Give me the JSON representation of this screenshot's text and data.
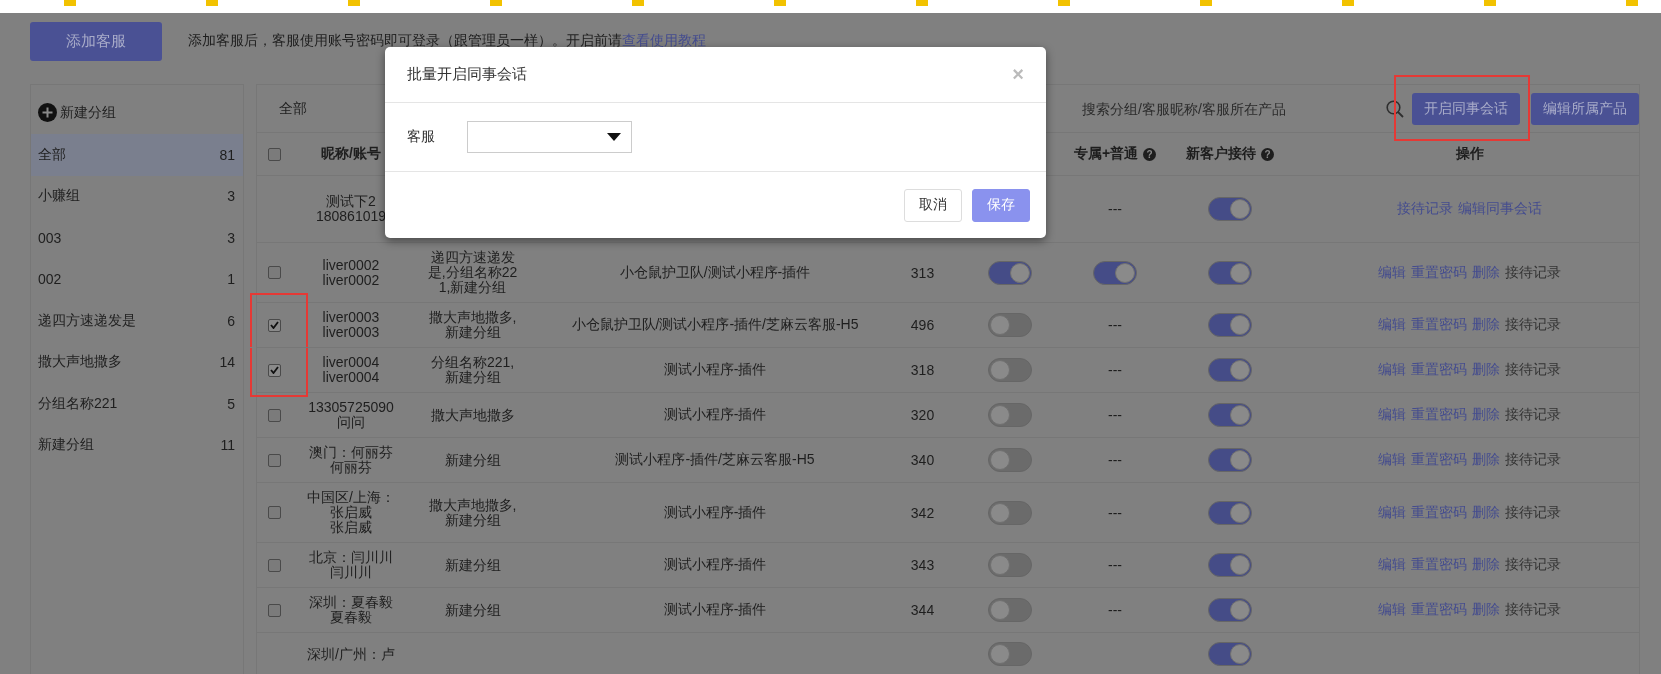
{
  "top_bar": {
    "add_button": "添加客服",
    "notice": "添加客服后，客服使用账号密码即可登录（跟管理员一样）。开启前请",
    "notice_link": "查看使用教程"
  },
  "sidebar": {
    "new_group": "新建分组",
    "items": [
      {
        "label": "全部",
        "count": "81",
        "selected": true
      },
      {
        "label": "小赚组",
        "count": "3",
        "selected": false
      },
      {
        "label": "003",
        "count": "3",
        "selected": false
      },
      {
        "label": "002",
        "count": "1",
        "selected": false
      },
      {
        "label": "递四方速递发是",
        "count": "6",
        "selected": false
      },
      {
        "label": "撒大声地撒多",
        "count": "14",
        "selected": false
      },
      {
        "label": "分组名称221",
        "count": "5",
        "selected": false
      },
      {
        "label": "新建分组",
        "count": "11",
        "selected": false
      }
    ]
  },
  "toolbar": {
    "filter": "全部",
    "search_placeholder": "搜索分组/客服昵称/客服所在产品",
    "buttons": [
      {
        "label": "开启同事会话",
        "highlighted": true
      },
      {
        "label": "编辑所属产品",
        "highlighted": false
      }
    ]
  },
  "table": {
    "select_all": {
      "checked": false
    },
    "columns": [
      {
        "kind": "nickname",
        "label": "昵称/账号"
      },
      {
        "kind": "exclusive",
        "label": "专属+普通",
        "help": "?"
      },
      {
        "kind": "new_customer",
        "label": "新客户接待",
        "help": "?"
      },
      {
        "kind": "actions",
        "label": "操作"
      }
    ],
    "rows": [
      {
        "nickname": "测试下2",
        "account": "180861019",
        "exclusive": {
          "kind": "text",
          "text": "---"
        },
        "new_customer": true,
        "actions": [
          {
            "label": "接待记录",
            "kind": "link"
          },
          {
            "label": "编辑同事会话",
            "kind": "link"
          }
        ]
      },
      {
        "checked": false,
        "highlighted": false,
        "nickname": "liver0002",
        "account": "liver0002",
        "group": "递四方速递发是,分组名称221,新建分组",
        "product": "小仓鼠护卫队/测试小程序-插件",
        "number": "313",
        "colleague_chat": true,
        "exclusive": {
          "kind": "toggle",
          "on": true
        },
        "new_customer": true,
        "actions": [
          {
            "label": "编辑",
            "kind": "link"
          },
          {
            "label": "重置密码",
            "kind": "link"
          },
          {
            "label": "删除",
            "kind": "link"
          },
          {
            "label": "接待记录",
            "kind": "muted"
          }
        ]
      },
      {
        "checked": true,
        "highlighted": true,
        "nickname": "liver0003",
        "account": "liver0003",
        "group": "撒大声地撒多,新建分组",
        "product": "小仓鼠护卫队/测试小程序-插件/芝麻云客服-H5",
        "number": "496",
        "colleague_chat": false,
        "exclusive": {
          "kind": "text",
          "text": "---"
        },
        "new_customer": true,
        "actions": [
          {
            "label": "编辑",
            "kind": "link"
          },
          {
            "label": "重置密码",
            "kind": "link"
          },
          {
            "label": "删除",
            "kind": "link"
          },
          {
            "label": "接待记录",
            "kind": "muted"
          }
        ]
      },
      {
        "checked": true,
        "highlighted": true,
        "nickname": "liver0004",
        "account": "liver0004",
        "group": "分组名称221,新建分组",
        "product": "测试小程序-插件",
        "number": "318",
        "colleague_chat": false,
        "exclusive": {
          "kind": "text",
          "text": "---"
        },
        "new_customer": true,
        "actions": [
          {
            "label": "编辑",
            "kind": "link"
          },
          {
            "label": "重置密码",
            "kind": "link"
          },
          {
            "label": "删除",
            "kind": "link"
          },
          {
            "label": "接待记录",
            "kind": "muted"
          }
        ]
      },
      {
        "checked": false,
        "highlighted": false,
        "nickname": "13305725090",
        "account": "问问",
        "group": "撒大声地撒多",
        "product": "测试小程序-插件",
        "number": "320",
        "colleague_chat": false,
        "exclusive": {
          "kind": "text",
          "text": "---"
        },
        "new_customer": true,
        "actions": [
          {
            "label": "编辑",
            "kind": "link"
          },
          {
            "label": "重置密码",
            "kind": "link"
          },
          {
            "label": "删除",
            "kind": "link"
          },
          {
            "label": "接待记录",
            "kind": "muted"
          }
        ]
      },
      {
        "checked": false,
        "highlighted": false,
        "nickname": "澳门：何丽芬",
        "account": "何丽芬",
        "group": "新建分组",
        "product": "测试小程序-插件/芝麻云客服-H5",
        "number": "340",
        "colleague_chat": false,
        "exclusive": {
          "kind": "text",
          "text": "---"
        },
        "new_customer": true,
        "actions": [
          {
            "label": "编辑",
            "kind": "link"
          },
          {
            "label": "重置密码",
            "kind": "link"
          },
          {
            "label": "删除",
            "kind": "link"
          },
          {
            "label": "接待记录",
            "kind": "muted"
          }
        ]
      },
      {
        "checked": false,
        "highlighted": false,
        "nickname": "中国区/上海：张启威",
        "account": "张启威",
        "group": "撒大声地撒多,新建分组",
        "product": "测试小程序-插件",
        "number": "342",
        "colleague_chat": false,
        "exclusive": {
          "kind": "text",
          "text": "---"
        },
        "new_customer": true,
        "actions": [
          {
            "label": "编辑",
            "kind": "link"
          },
          {
            "label": "重置密码",
            "kind": "link"
          },
          {
            "label": "删除",
            "kind": "link"
          },
          {
            "label": "接待记录",
            "kind": "muted"
          }
        ]
      },
      {
        "checked": false,
        "highlighted": false,
        "nickname": "北京：闫川川",
        "account": "闫川川",
        "group": "新建分组",
        "product": "测试小程序-插件",
        "number": "343",
        "colleague_chat": false,
        "exclusive": {
          "kind": "text",
          "text": "---"
        },
        "new_customer": true,
        "actions": [
          {
            "label": "编辑",
            "kind": "link"
          },
          {
            "label": "重置密码",
            "kind": "link"
          },
          {
            "label": "删除",
            "kind": "link"
          },
          {
            "label": "接待记录",
            "kind": "muted"
          }
        ]
      },
      {
        "checked": false,
        "highlighted": false,
        "nickname": "深圳：夏春毅",
        "account": "夏春毅",
        "group": "新建分组",
        "product": "测试小程序-插件",
        "number": "344",
        "colleague_chat": false,
        "exclusive": {
          "kind": "text",
          "text": "---"
        },
        "new_customer": true,
        "actions": [
          {
            "label": "编辑",
            "kind": "link"
          },
          {
            "label": "重置密码",
            "kind": "link"
          },
          {
            "label": "删除",
            "kind": "link"
          },
          {
            "label": "接待记录",
            "kind": "muted"
          }
        ]
      },
      {
        "nickname": "深圳/广州：卢",
        "colleague_chat": false,
        "new_customer": true
      }
    ]
  },
  "modal": {
    "title": "批量开启同事会话",
    "close": "×",
    "field_label": "客服",
    "buttons": [
      {
        "label": "取消",
        "kind": "default"
      },
      {
        "label": "保存",
        "kind": "primary"
      }
    ]
  }
}
